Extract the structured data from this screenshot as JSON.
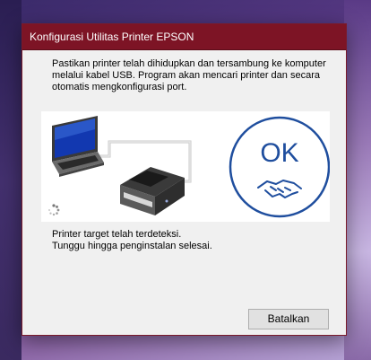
{
  "window": {
    "title": "Konfigurasi Utilitas Printer EPSON"
  },
  "message": {
    "lines": [
      "Pastikan printer telah dihidupkan dan tersambung ke komputer",
      "melalui kabel USB. Program akan mencari printer dan secara",
      "otomatis mengkonfigurasi port."
    ]
  },
  "illustration": {
    "ok_text": "OK",
    "icons": [
      "laptop-icon",
      "usb-cable-icon",
      "printer-icon",
      "handshake-icon",
      "loading-spinner-icon"
    ],
    "accent_color": "#1f4e9e"
  },
  "status": {
    "lines": [
      "Printer target telah terdeteksi.",
      "Tunggu hingga penginstalan selesai."
    ]
  },
  "buttons": {
    "cancel_label": "Batalkan"
  },
  "colors": {
    "titlebar": "#7d1425",
    "window_bg": "#f0f0f0"
  }
}
